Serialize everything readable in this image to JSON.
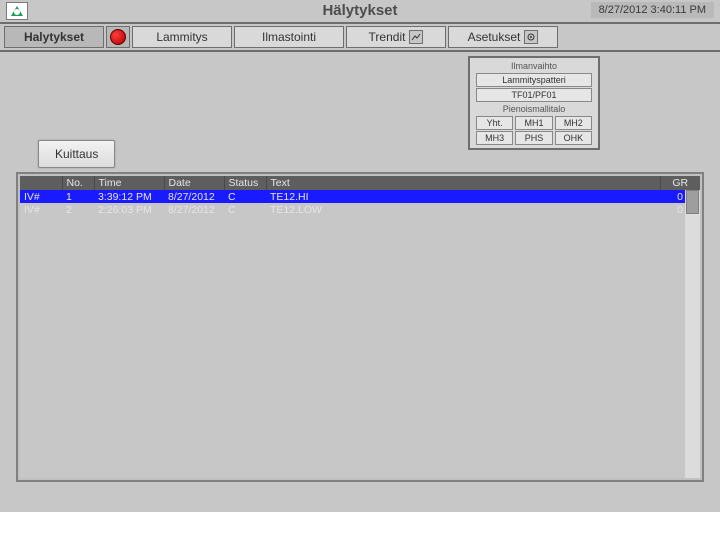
{
  "header": {
    "title": "Hälytykset",
    "datetime": "8/27/2012 3:40:11 PM"
  },
  "tabs": {
    "alarms": "Halytykset",
    "heating": "Lammitys",
    "ac": "Ilmastointi",
    "trends": "Trendit",
    "settings": "Asetukset"
  },
  "systems": {
    "header1": "Ilmanvaihto",
    "btn1": "Lammityspatteri",
    "btn2": "TF01/PF01",
    "header2": "Pienoismallitalo",
    "row1": [
      "Yht.",
      "MH1",
      "MH2"
    ],
    "row2": [
      "MH3",
      "PHS",
      "OHK"
    ]
  },
  "ack_label": "Kuittaus",
  "columns": {
    "iv": "",
    "no": "No.",
    "time": "Time",
    "date": "Date",
    "status": "Status",
    "text": "Text",
    "gr": "GR"
  },
  "rows": [
    {
      "iv": "IV#",
      "no": "1",
      "time": "3:39:12 PM",
      "date": "8/27/2012",
      "status": "C",
      "text": "TE12.HI",
      "gr": "0",
      "selected": true
    },
    {
      "iv": "IV#",
      "no": "2",
      "time": "2:26:03 PM",
      "date": "8/27/2012",
      "status": "C",
      "text": "TE12.LOW",
      "gr": "0",
      "selected": false
    }
  ]
}
